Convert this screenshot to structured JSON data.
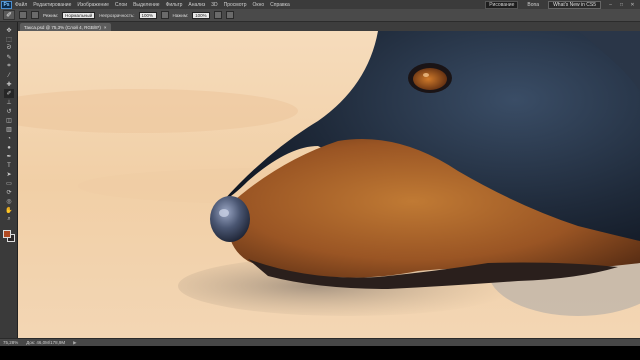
{
  "app": {
    "logo": "Ps"
  },
  "menu": {
    "items": [
      "Файл",
      "Редактирование",
      "Изображение",
      "Слои",
      "Выделение",
      "Фильтр",
      "Анализ",
      "3D",
      "Просмотр",
      "Окно",
      "Справка"
    ]
  },
  "workspace": {
    "items": [
      "Рисование",
      "Bona"
    ],
    "active": "Рисование",
    "cs_live": "What's New in CS5"
  },
  "window_controls": {
    "minimize": "–",
    "maximize": "□",
    "close": "✕"
  },
  "options": {
    "mode_label": "Режим:",
    "mode_value": "Нормальный",
    "opacity_label": "Непрозрачность:",
    "opacity_value": "100%",
    "pressure_label": "Нажим:",
    "pressure_value": "100%"
  },
  "document": {
    "tab_title": "Такса.psd @ 75,3% (Слой 4, RGB/8*)",
    "tab_close": "×"
  },
  "status": {
    "zoom": "75,28%",
    "doc_info": "Док: 46,0M/178,9M",
    "arrow": "▶"
  },
  "tools": [
    {
      "name": "move-tool",
      "glyph": "✥"
    },
    {
      "name": "marquee-tool",
      "glyph": "⬚"
    },
    {
      "name": "lasso-tool",
      "glyph": "ᘐ"
    },
    {
      "name": "quick-select-tool",
      "glyph": "✎"
    },
    {
      "name": "crop-tool",
      "glyph": "⌗"
    },
    {
      "name": "eyedropper-tool",
      "glyph": "⁄"
    },
    {
      "name": "healing-tool",
      "glyph": "✚"
    },
    {
      "name": "brush-tool",
      "glyph": "✐"
    },
    {
      "name": "stamp-tool",
      "glyph": "⊥"
    },
    {
      "name": "history-brush-tool",
      "glyph": "↺"
    },
    {
      "name": "eraser-tool",
      "glyph": "◫"
    },
    {
      "name": "gradient-tool",
      "glyph": "▥"
    },
    {
      "name": "blur-tool",
      "glyph": "◔"
    },
    {
      "name": "dodge-tool",
      "glyph": "●"
    },
    {
      "name": "pen-tool",
      "glyph": "✒"
    },
    {
      "name": "type-tool",
      "glyph": "T"
    },
    {
      "name": "path-select-tool",
      "glyph": "➤"
    },
    {
      "name": "shape-tool",
      "glyph": "▭"
    },
    {
      "name": "3d-rotate-tool",
      "glyph": "⟳"
    },
    {
      "name": "3d-orbit-tool",
      "glyph": "◎"
    },
    {
      "name": "hand-tool",
      "glyph": "✋"
    },
    {
      "name": "zoom-tool",
      "glyph": "⌕"
    }
  ],
  "colors": {
    "foreground": "#b04a22",
    "background": "#2e2a2a",
    "canvas_bg": "#f2d5b2",
    "dog_black": "#1f2a3a",
    "dog_tan": "#a8622a"
  }
}
